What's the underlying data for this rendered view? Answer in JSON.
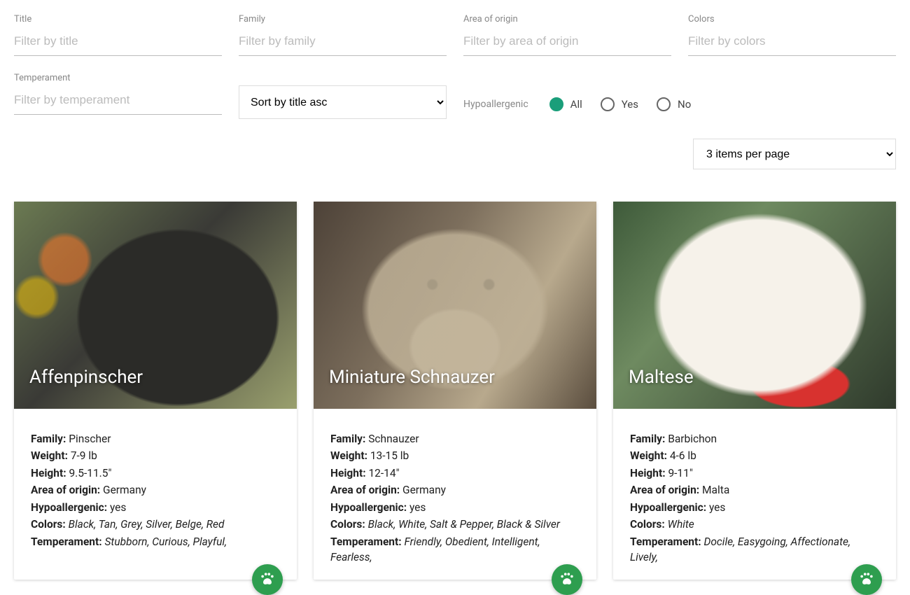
{
  "filters": {
    "title": {
      "label": "Title",
      "placeholder": "Filter by title"
    },
    "family": {
      "label": "Family",
      "placeholder": "Filter by family"
    },
    "area": {
      "label": "Area of origin",
      "placeholder": "Filter by area of origin"
    },
    "colors": {
      "label": "Colors",
      "placeholder": "Filter by colors"
    },
    "temperament": {
      "label": "Temperament",
      "placeholder": "Filter by temperament"
    }
  },
  "sort": {
    "selected": "Sort by title asc"
  },
  "hypo": {
    "label": "Hypoallergenic",
    "options": {
      "all": "All",
      "yes": "Yes",
      "no": "No"
    },
    "selected": "all"
  },
  "perpage": {
    "selected": "3 items per page"
  },
  "specs": {
    "family": "Family:",
    "weight": "Weight:",
    "height": "Height:",
    "area": "Area of origin:",
    "hypo": "Hypoallergenic:",
    "colors": "Colors:",
    "temperament": "Temperament:"
  },
  "cards": [
    {
      "title": "Affenpinscher",
      "family": "Pinscher",
      "weight": "7-9 lb",
      "height": "9.5-11.5\"",
      "area": "Germany",
      "hypo": "yes",
      "colors": "Black, Tan, Grey, Silver, Belge, Red",
      "temperament": "Stubborn, Curious, Playful,"
    },
    {
      "title": "Miniature Schnauzer",
      "family": "Schnauzer",
      "weight": "13-15 lb",
      "height": "12-14\"",
      "area": "Germany",
      "hypo": "yes",
      "colors": "Black, White, Salt & Pepper, Black & Silver",
      "temperament": "Friendly, Obedient, Intelligent, Fearless,"
    },
    {
      "title": "Maltese",
      "family": "Barbichon",
      "weight": "4-6 lb",
      "height": "9-11\"",
      "area": "Malta",
      "hypo": "yes",
      "colors": "White",
      "temperament": "Docile, Easygoing, Affectionate, Lively,"
    }
  ]
}
